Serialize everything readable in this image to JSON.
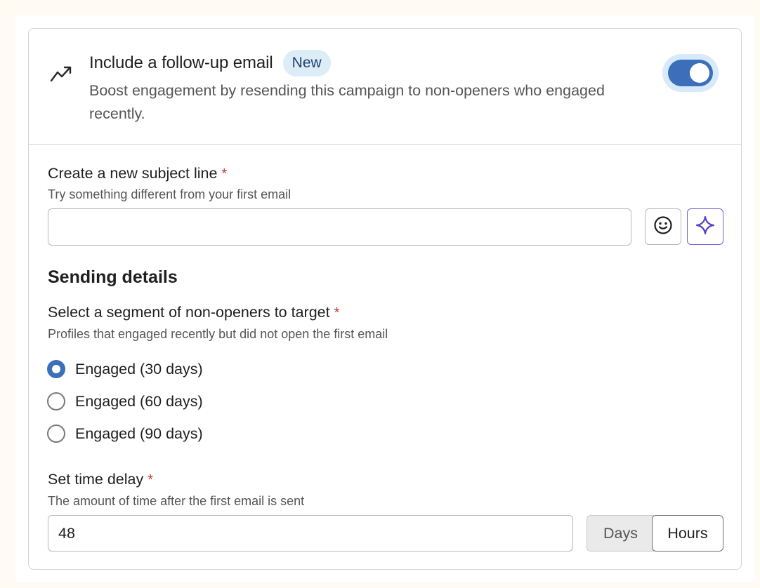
{
  "header": {
    "title": "Include a follow-up email",
    "badge": "New",
    "description": "Boost engagement by resending this campaign to non-openers who engaged recently.",
    "toggle_on": true,
    "icon": "trending-up-icon"
  },
  "subject": {
    "label": "Create a new subject line",
    "required_mark": "*",
    "hint": "Try something different from your first email",
    "value": "",
    "emoji_icon": "emoji-icon",
    "ai_icon": "sparkle-icon"
  },
  "sending": {
    "title": "Sending details",
    "segment": {
      "label": "Select a segment of non-openers to target",
      "required_mark": "*",
      "hint": "Profiles that engaged recently but did not open the first email",
      "options": [
        {
          "label": "Engaged (30 days)",
          "checked": true
        },
        {
          "label": "Engaged (60 days)",
          "checked": false
        },
        {
          "label": "Engaged (90 days)",
          "checked": false
        }
      ]
    },
    "delay": {
      "label": "Set time delay",
      "required_mark": "*",
      "hint": "The amount of time after the first email is sent",
      "value": "48",
      "units": [
        "Days",
        "Hours"
      ],
      "selected_unit": "Hours"
    }
  },
  "colors": {
    "accent": "#3b6fba",
    "badge_bg": "#dcedf8",
    "required": "#c0392b",
    "ai_accent": "#7a5fd8",
    "page_bg": "#fffaf2"
  }
}
